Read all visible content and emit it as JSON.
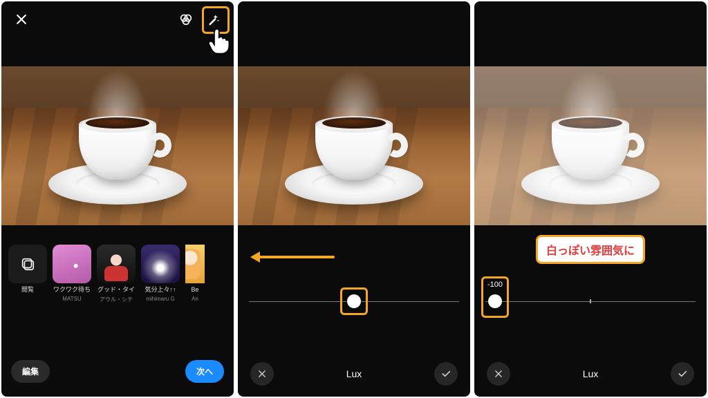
{
  "colors": {
    "highlight": "#f5a623",
    "callout_text": "#e23b3b",
    "next_btn": "#1a8cff"
  },
  "panel1": {
    "filters_browse_label": "閲覧",
    "filters": [
      {
        "title": "ワクワク待ち",
        "subtitle": "MATSU"
      },
      {
        "title": "グッド・タイ",
        "subtitle": "アウル・シテ"
      },
      {
        "title": "気分上々↑↑",
        "subtitle": "mihimaru G"
      },
      {
        "title": "Be",
        "subtitle": "An"
      }
    ],
    "edit_label": "編集",
    "next_label": "次へ"
  },
  "panel2": {
    "tool_name": "Lux",
    "slider_value": 0
  },
  "panel3": {
    "callout_text": "白っぽい雰囲気に",
    "slider_value_label": "-100",
    "slider_value": -100,
    "tool_name": "Lux"
  }
}
